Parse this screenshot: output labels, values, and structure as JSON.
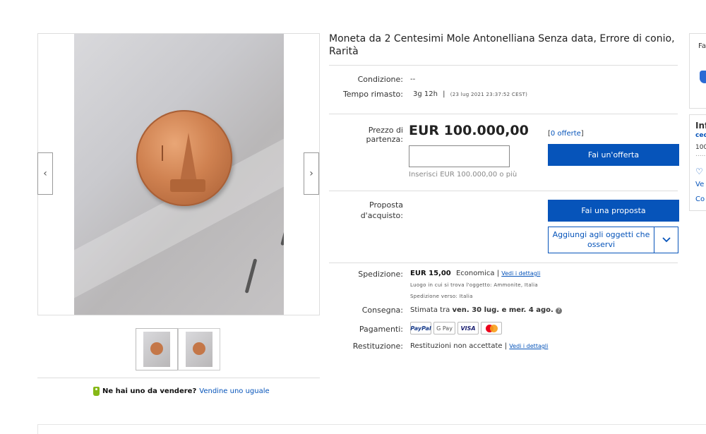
{
  "gallery": {
    "prev_glyph": "‹",
    "next_glyph": "›",
    "thumb_count": 2
  },
  "sell_prompt": {
    "question": "Ne hai uno da vendere?",
    "link": "Vendine uno uguale"
  },
  "listing": {
    "title": "Moneta da 2 Centesimi Mole Antonelliana Senza data, Errore di conio, Rarità",
    "condition_label": "Condizione:",
    "condition_value": "--",
    "time_label": "Tempo rimasto:",
    "time_value": "3g 12h",
    "time_sep": "|",
    "time_end": "(23 lug 2021  23:37:52 CEST)",
    "start_price_label": "Prezzo di partenza:",
    "price": "EUR 100.000,00",
    "offers_open": "[",
    "offers_link": "0 offerte",
    "offers_close": "]",
    "bid_input_value": "",
    "bid_hint": "Inserisci EUR 100.000,00 o più",
    "bid_button": "Fai un'offerta",
    "proposal_label": "Proposta d'acquisto:",
    "proposal_button": "Fai una proposta",
    "watch_button": "Aggiungi agli oggetti che osservi",
    "watch_dropdown_icon": "chevron-down-icon"
  },
  "shipping": {
    "label": "Spedizione:",
    "price": "EUR 15,00",
    "method": "Economica",
    "sep": "|",
    "details_link": "Vedi i dettagli",
    "location": "Luogo in cui si trova l'oggetto:  Ammonite, Italia",
    "ships_to": "Spedizione verso:  Italia"
  },
  "delivery": {
    "label": "Consegna:",
    "prefix": "Stimata tra",
    "dates": "ven. 30 lug. e mer. 4 ago."
  },
  "payments": {
    "label": "Pagamenti:",
    "paypal": "PayPal",
    "gpay": "G Pay",
    "visa": "VISA"
  },
  "returns": {
    "label": "Restituzione:",
    "value": "Restituzioni non accettate |",
    "details_link": "Vedi i dettagli"
  },
  "side": {
    "box1_text": "Fa",
    "box2_title": "Inf",
    "box2_link": "cec",
    "box2_line": "100",
    "box2_dots": ".....",
    "box2_link2": "Ve",
    "box2_link3": "Co"
  },
  "colors": {
    "accent": "#0654ba",
    "brand_green": "#86b817"
  }
}
